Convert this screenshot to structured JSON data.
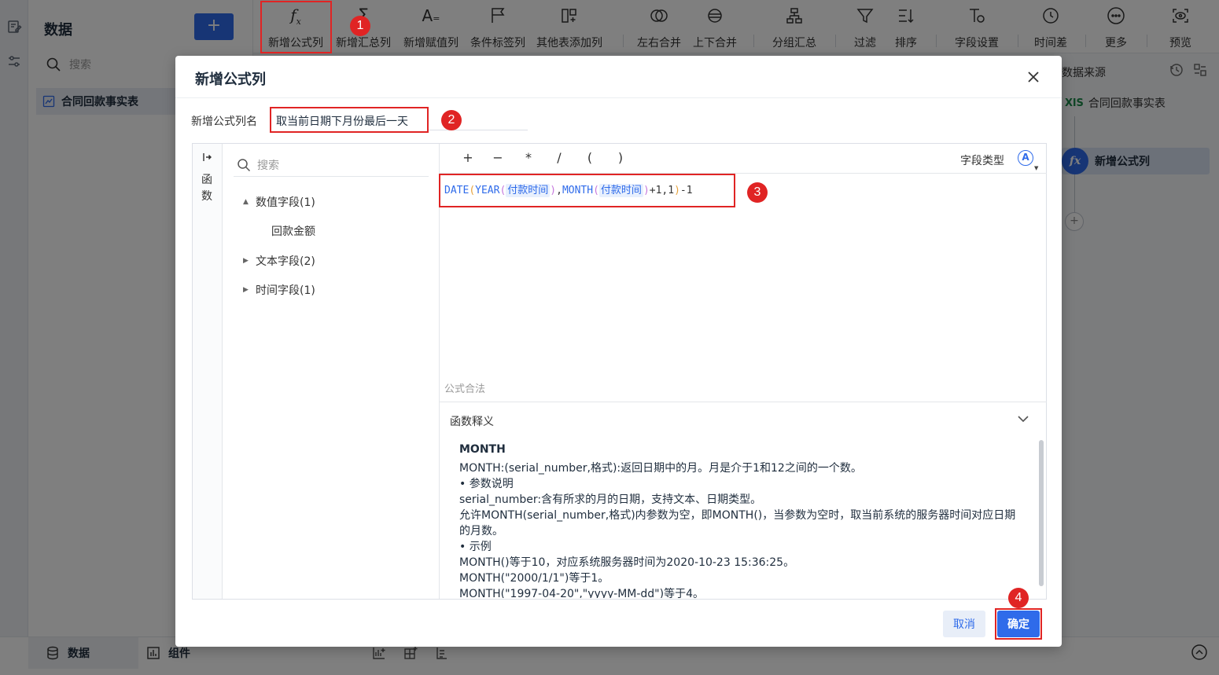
{
  "app": {
    "data_panel_title": "数据",
    "add_label": "+",
    "search_placeholder": "搜索",
    "table_item": "合同回款事实表"
  },
  "toolbar": {
    "items": [
      {
        "label": "新增公式列",
        "icon": "fx-icon"
      },
      {
        "label": "新增汇总列",
        "icon": "sigma-icon"
      },
      {
        "label": "新增赋值列",
        "icon": "assign-icon"
      },
      {
        "label": "条件标签列",
        "icon": "flag-icon"
      },
      {
        "label": "其他表添加列",
        "icon": "add-column-icon"
      },
      {
        "label": "左右合并",
        "icon": "merge-horizontal-icon"
      },
      {
        "label": "上下合并",
        "icon": "merge-vertical-icon"
      },
      {
        "label": "分组汇总",
        "icon": "group-icon"
      },
      {
        "label": "过滤",
        "icon": "filter-icon"
      },
      {
        "label": "排序",
        "icon": "sort-icon"
      },
      {
        "label": "字段设置",
        "icon": "field-settings-icon"
      },
      {
        "label": "时间差",
        "icon": "clock-icon"
      },
      {
        "label": "更多",
        "icon": "more-icon"
      },
      {
        "label": "预览",
        "icon": "preview-icon"
      }
    ]
  },
  "right_panel": {
    "title": "数据来源",
    "source_badge": "XlS",
    "source_name": "合同回款事实表",
    "step_fx": "fx",
    "step_name": "新增公式列",
    "add_step": "+"
  },
  "bottom": {
    "tab_data": "数据",
    "tab_component": "组件"
  },
  "dialog": {
    "title": "新增公式列",
    "name_label": "新增公式列名",
    "name_value": "取当前日期下月份最后一天",
    "fn_rail_label": "函数",
    "field_search_placeholder": "搜索",
    "tree": [
      {
        "label": "数值字段(1)",
        "expanded": true
      },
      {
        "label": "回款金额"
      },
      {
        "label": "文本字段(2)",
        "expanded": false
      },
      {
        "label": "时间字段(1)",
        "expanded": false
      }
    ],
    "operators": [
      "+",
      "−",
      "*",
      "/",
      "(",
      ")"
    ],
    "field_type_label": "字段类型",
    "field_type_icon": "A",
    "formula": {
      "date_fn": "DATE",
      "year_fn": "YEAR",
      "month_fn": "MONTH",
      "open": "(",
      "close": ")",
      "field": "付款时间",
      "comma": ",",
      "tail": "+1,1",
      "end": "-1"
    },
    "validity": "公式合法",
    "fn_desc_title": "函数释义",
    "fn_desc": {
      "name": "MONTH",
      "lines": [
        "MONTH:(serial_number,格式):返回日期中的月。月是介于1和12之间的一个数。",
        "•  参数说明",
        "serial_number:含有所求的月的日期，支持文本、日期类型。",
        "允许MONTH(serial_number,格式)内参数为空，即MONTH()，当参数为空时，取当前系统的服务器时间对应日期的月数。",
        "•  示例",
        "MONTH()等于10，对应系统服务器时间为2020-10-23 15:36:25。",
        "MONTH(\"2000/1/1\")等于1。",
        "MONTH(\"1997-04-20\",\"yyyy-MM-dd\")等于4。"
      ]
    },
    "cancel_label": "取消",
    "ok_label": "确定"
  },
  "annotations": [
    "1",
    "2",
    "3",
    "4"
  ],
  "colors": {
    "accent": "#2f6bea",
    "annotation": "#e02424"
  }
}
